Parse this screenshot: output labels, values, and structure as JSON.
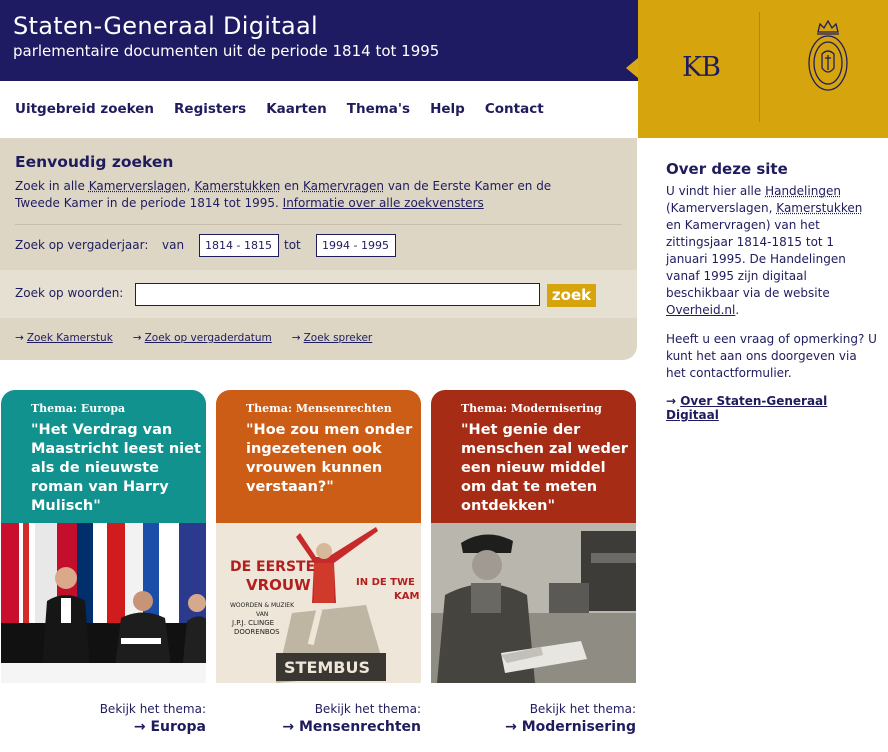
{
  "header": {
    "title": "Staten-Generaal Digitaal",
    "subtitle": "parlementaire documenten uit de periode 1814 tot 1995",
    "kb_logo": "KB",
    "brand_color": "#1e1b63",
    "accent_color": "#d6a50e"
  },
  "nav": {
    "items": [
      "Uitgebreid zoeken",
      "Registers",
      "Kaarten",
      "Thema's",
      "Help",
      "Contact"
    ]
  },
  "search": {
    "title": "Eenvoudig zoeken",
    "intro_1": "Zoek in alle ",
    "intro_kamerverslagen": "Kamerverslagen",
    "intro_comma": ", ",
    "intro_kamerstukken": "Kamerstukken",
    "intro_en": " en ",
    "intro_kamervragen": "Kamervragen",
    "intro_2": " van de Eerste Kamer en de Tweede Kamer in de periode 1814 tot 1995.  ",
    "intro_link": "Informatie over alle zoekvensters",
    "year_label": "Zoek op vergaderjaar:",
    "van": "van",
    "tot": "tot",
    "year_from": "1814 - 1815",
    "year_to": "1994 - 1995",
    "words_label": "Zoek op woorden:",
    "words_value": "",
    "button": "zoek",
    "quick_links": [
      "Zoek Kamerstuk",
      "Zoek op vergaderdatum",
      "Zoek spreker"
    ]
  },
  "sidebar": {
    "title": "Over deze site",
    "t1": "U vindt hier alle ",
    "handelingen": "Handelingen",
    "t2": " (Kamerverslagen, ",
    "kamerstukken": "Kamerstukken",
    "t3": " en Kamervragen) van het zittingsjaar 1814-1815 tot 1 januari 1995. De Handelingen vanaf 1995 zijn digitaal beschikbaar via de website ",
    "overheid": "Overheid.nl",
    "t4": ".",
    "p2": "Heeft u een vraag of opmerking? U kunt het aan ons doorgeven via het ",
    "contact_link": "contactformulier",
    "p2_end": ".",
    "link": "Over Staten-Generaal Digitaal"
  },
  "cards": [
    {
      "tag": "Thema: Europa",
      "quote": "\"Het Verdrag van Maastricht leest niet als de nieuwste roman van Harry Mulisch\"",
      "view_label": "Bekijk het thema:",
      "theme": "Europa",
      "color": "#12928f"
    },
    {
      "tag": "Thema: Mensenrechten",
      "quote": "\"Hoe zou men onder ingezetenen ook vrouwen kunnen verstaan?\"",
      "view_label": "Bekijk het thema:",
      "theme": "Mensenrechten",
      "color": "#cc5d16"
    },
    {
      "tag": "Thema: Modernisering",
      "quote": "\"Het genie der menschen zal weder een nieuw middel om dat te meten ontdekken\"",
      "view_label": "Bekijk het thema:",
      "theme": "Modernisering",
      "color": "#a62c16"
    }
  ],
  "poster": {
    "line1": "DE EERSTE",
    "line2": "VROUW",
    "line3": "IN DE TWE",
    "line4": "KAM",
    "small1": "WOORDEN & MUZIEK",
    "small2": "VAN",
    "small3": "J.P.J. CLINGE",
    "small4": "DOORENBOS",
    "box": "STEMBUS"
  }
}
